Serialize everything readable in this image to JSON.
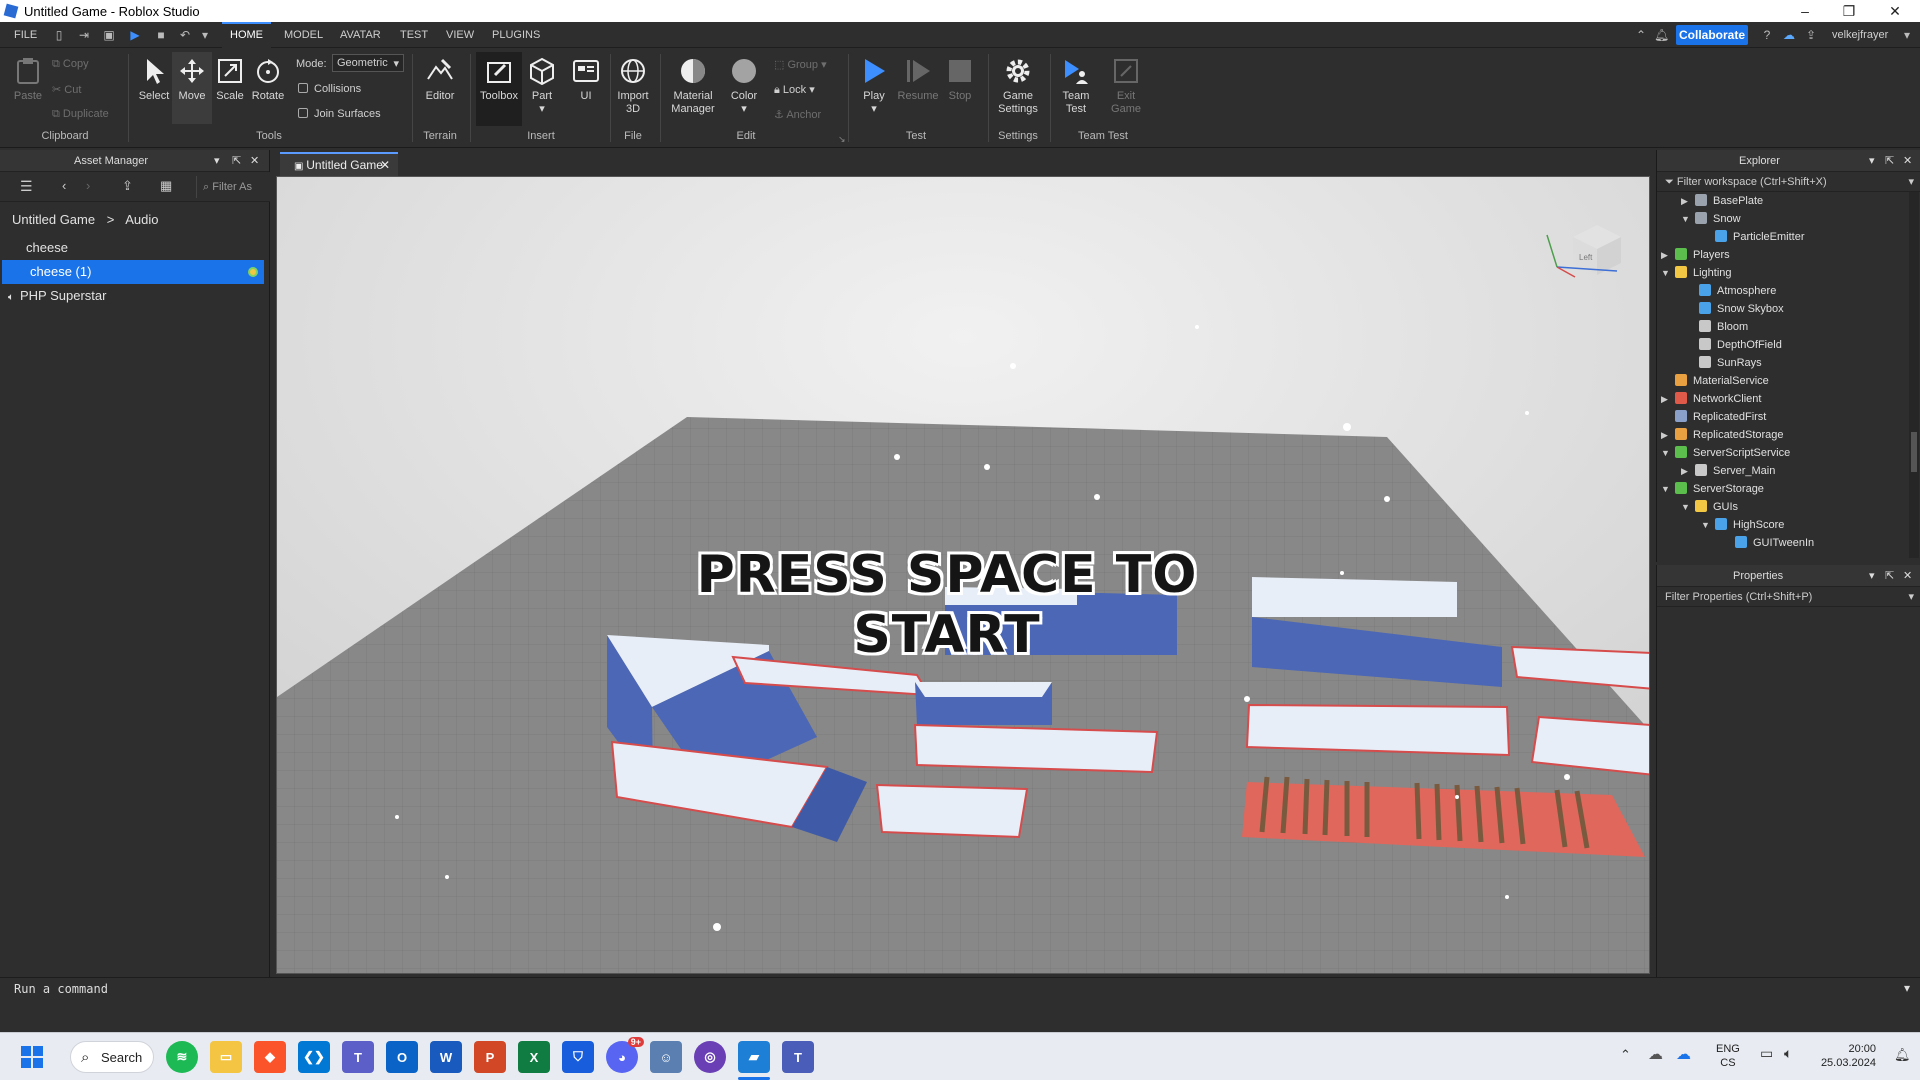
{
  "window": {
    "title": "Untitled Game - Roblox Studio",
    "min": "–",
    "max": "❐",
    "close": "✕"
  },
  "menu": {
    "file": "FILE",
    "tabs": [
      "HOME",
      "MODEL",
      "AVATAR",
      "TEST",
      "VIEW",
      "PLUGINS"
    ],
    "collaborate": "Collaborate",
    "user": "velkejfrayer"
  },
  "ribbon": {
    "clipboard": {
      "paste": "Paste",
      "copy": "Copy",
      "cut": "Cut",
      "duplicate": "Duplicate",
      "group": "Clipboard"
    },
    "tools": {
      "select": "Select",
      "move": "Move",
      "scale": "Scale",
      "rotate": "Rotate",
      "mode_label": "Mode:",
      "mode_value": "Geometric",
      "collisions": "Collisions",
      "join_surfaces": "Join Surfaces",
      "group": "Tools"
    },
    "terrain": {
      "editor": "Editor",
      "group": "Terrain"
    },
    "insert": {
      "toolbox": "Toolbox",
      "part": "Part",
      "ui": "UI",
      "group": "Insert"
    },
    "file": {
      "import3d_1": "Import",
      "import3d_2": "3D",
      "group": "File"
    },
    "edit": {
      "material_1": "Material",
      "material_2": "Manager",
      "color": "Color",
      "group_btn": "Group",
      "lock": "Lock",
      "anchor": "Anchor",
      "group": "Edit"
    },
    "test": {
      "play": "Play",
      "resume": "Resume",
      "stop": "Stop",
      "group": "Test"
    },
    "settings": {
      "game_1": "Game",
      "game_2": "Settings",
      "group": "Settings"
    },
    "teamtest": {
      "team_1": "Team",
      "team_2": "Test",
      "exit_1": "Exit",
      "exit_2": "Game",
      "group": "Team Test"
    }
  },
  "asset_manager": {
    "title": "Asset Manager",
    "filter_placeholder": "Filter As",
    "breadcrumb_root": "Untitled Game",
    "breadcrumb_sep": ">",
    "breadcrumb_leaf": "Audio",
    "items": [
      "cheese",
      "cheese (1)"
    ],
    "sound_item": "PHP Superstar"
  },
  "viewport": {
    "tab": "Untitled Game",
    "overlay": "PRESS SPACE TO START",
    "cube_label": "Left"
  },
  "command_bar": {
    "placeholder": "Run a command"
  },
  "explorer": {
    "title": "Explorer",
    "filter": "Filter workspace (Ctrl+Shift+X)",
    "items": [
      {
        "label": "BasePlate",
        "arrow": "▶",
        "color": "#9aa3ad"
      },
      {
        "label": "Snow",
        "arrow": "▼",
        "color": "#9aa3ad"
      },
      {
        "label": "ParticleEmitter",
        "arrow": "",
        "color": "#4aa3e8"
      },
      {
        "label": "Players",
        "arrow": "▶",
        "color": "#5cbf4d"
      },
      {
        "label": "Lighting",
        "arrow": "▼",
        "color": "#f2c744"
      },
      {
        "label": "Atmosphere",
        "arrow": "",
        "color": "#4aa3e8"
      },
      {
        "label": "Snow Skybox",
        "arrow": "",
        "color": "#4aa3e8"
      },
      {
        "label": "Bloom",
        "arrow": "",
        "color": "#c8c8c8"
      },
      {
        "label": "DepthOfField",
        "arrow": "",
        "color": "#c8c8c8"
      },
      {
        "label": "SunRays",
        "arrow": "",
        "color": "#c8c8c8"
      },
      {
        "label": "MaterialService",
        "arrow": "",
        "color": "#e8a040"
      },
      {
        "label": "NetworkClient",
        "arrow": "▶",
        "color": "#e05a4a"
      },
      {
        "label": "ReplicatedFirst",
        "arrow": "",
        "color": "#8aa0c8"
      },
      {
        "label": "ReplicatedStorage",
        "arrow": "▶",
        "color": "#e8a040"
      },
      {
        "label": "ServerScriptService",
        "arrow": "▼",
        "color": "#5cbf4d"
      },
      {
        "label": "Server_Main",
        "arrow": "▶",
        "color": "#c8c8c8"
      },
      {
        "label": "ServerStorage",
        "arrow": "▼",
        "color": "#5cbf4d"
      },
      {
        "label": "GUIs",
        "arrow": "▼",
        "color": "#f2c744"
      },
      {
        "label": "HighScore",
        "arrow": "▼",
        "color": "#4aa3e8"
      },
      {
        "label": "GUITweenIn",
        "arrow": "",
        "color": "#4aa3e8"
      }
    ]
  },
  "properties": {
    "title": "Properties",
    "filter": "Filter Properties (Ctrl+Shift+P)"
  },
  "taskbar": {
    "search": "Search",
    "lang_1": "ENG",
    "lang_2": "CS",
    "time": "20:00",
    "date": "25.03.2024",
    "discord_badge": "9+"
  }
}
